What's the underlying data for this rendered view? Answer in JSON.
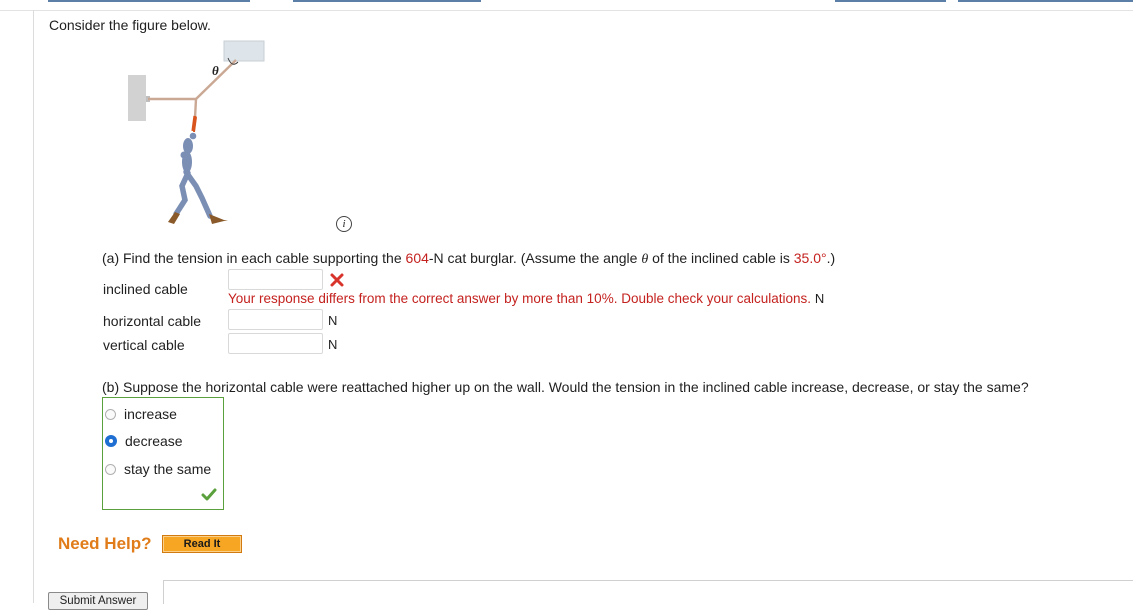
{
  "intro": "Consider the figure below.",
  "figure": {
    "theta_symbol": "θ"
  },
  "info_icon_glyph": "i",
  "part_a": {
    "prefix": "(a) Find the tension in each cable supporting the ",
    "weight": "604",
    "mid": "-N cat burglar. (Assume the angle ",
    "theta": "θ",
    "mid2": " of the inclined cable is ",
    "angle": "35.0°",
    "suffix": ".)",
    "rows": [
      {
        "label": "inclined cable",
        "value": "",
        "unit": "N"
      },
      {
        "label": "horizontal cable",
        "value": "",
        "unit": "N"
      },
      {
        "label": "vertical cable",
        "value": "",
        "unit": "N"
      }
    ],
    "feedback": "Your response differs from the correct answer by more than 10%. Double check your calculations."
  },
  "part_b": {
    "question": "(b) Suppose the horizontal cable were reattached higher up on the wall. Would the tension in the inclined cable increase, decrease, or stay the same?",
    "options": [
      {
        "label": "increase",
        "selected": false
      },
      {
        "label": "decrease",
        "selected": true
      },
      {
        "label": "stay the same",
        "selected": false
      }
    ]
  },
  "help": {
    "need_help": "Need Help?",
    "read_it": "Read It"
  },
  "submit_label": "Submit Answer",
  "colors": {
    "error": "#c4221f",
    "correct": "#5aa03c",
    "help_orange": "#e07c1a",
    "radio_selected": "#1e6fd1"
  }
}
